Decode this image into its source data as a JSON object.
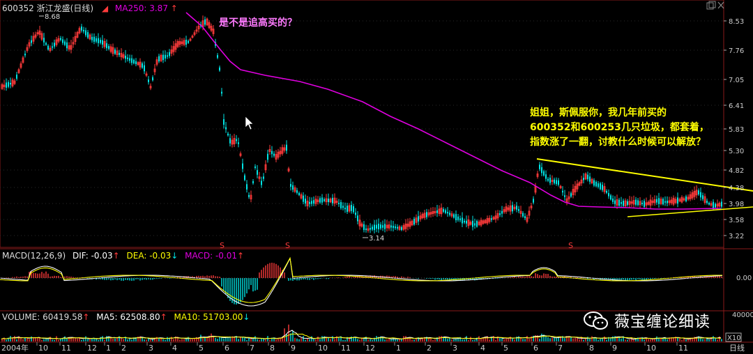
{
  "header": {
    "code": "600352",
    "name_period": "浙江龙盛(日线)",
    "ma_label": "MA250: 3.87",
    "ma_arrow": "↑",
    "high_marker": "8.68",
    "low_marker": "3.14"
  },
  "annotations": {
    "question": "是不是追高买的？",
    "comment_line1": "姐姐，斯佩服你，我几年前买的",
    "comment_line2": "600352和600253几只垃圾，都套着，",
    "comment_line3": "指数涨了一翻，讨教什么时候可以解放？"
  },
  "price_axis": [
    "8.53",
    "7.76",
    "7.05",
    "6.41",
    "5.83",
    "5.30",
    "4.82",
    "4.38",
    "3.98",
    "3.58",
    "3.22"
  ],
  "s_markers": [
    "S",
    "S",
    "S"
  ],
  "macd": {
    "label": "MACD(12,26,9)",
    "dif": "DIF: -0.03",
    "dif_arrow": "↑",
    "dea": "DEA: -0.03",
    "dea_arrow": "↓",
    "macd": "MACD: -0.01",
    "macd_arrow": "↑",
    "axis_value": "0.00"
  },
  "volume": {
    "label": "VOLUME: 60419.58",
    "label_arrow": "↑",
    "ma5": "MA5: 62508.80",
    "ma5_arrow": "↑",
    "ma10": "MA10: 51703.00",
    "ma10_arrow": "↓",
    "axis_value": "40000",
    "multiplier": "X10"
  },
  "time_axis": {
    "year": "2004年",
    "months": [
      "10",
      "11",
      "12",
      "1",
      "2",
      "3",
      "4",
      "5",
      "6",
      "7",
      "8",
      "9",
      "10",
      "11",
      "12",
      "1",
      "2",
      "3",
      "4",
      "5",
      "6",
      "7",
      "8",
      "9",
      "10",
      "11"
    ],
    "period_tab": "日线"
  },
  "watermark": {
    "text": "薇宝缠论细读"
  },
  "colors": {
    "background": "#000000",
    "up": "#ff3b3b",
    "down": "#00e5e5",
    "ma250": "#e000e0",
    "trendline": "#ffff00",
    "annotation_pink": "#ff7aff",
    "annotation_yellow": "#ffff00"
  }
}
